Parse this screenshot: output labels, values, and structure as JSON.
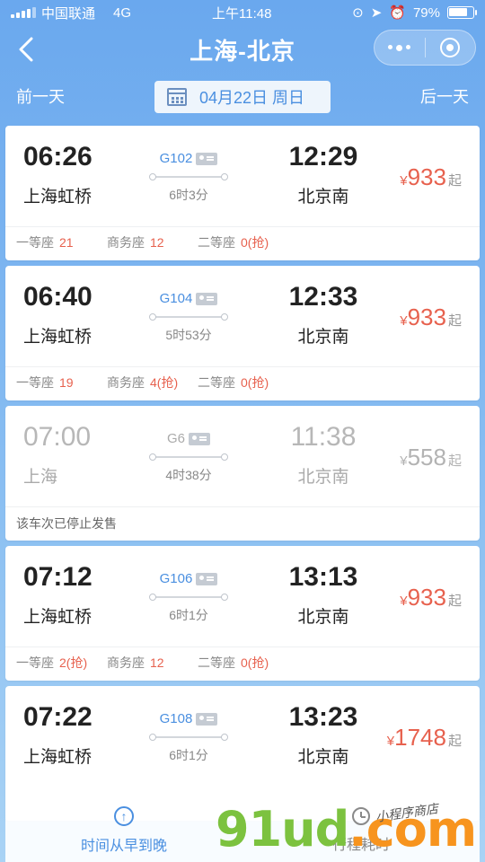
{
  "status_bar": {
    "carrier": "中国联通",
    "network": "4G",
    "time": "上午11:48",
    "battery": "79%",
    "battery_level": 0.79
  },
  "nav": {
    "title": "上海-北京"
  },
  "date_bar": {
    "prev_label": "前一天",
    "date": "04月22日 周日",
    "next_label": "后一天"
  },
  "trains": [
    {
      "dep_time": "06:26",
      "dep_station": "上海虹桥",
      "train_no": "G102",
      "duration": "6时3分",
      "arr_time": "12:29",
      "arr_station": "北京南",
      "price": "933",
      "price_prefix": "¥",
      "price_suffix": "起",
      "seats": [
        {
          "name": "一等座",
          "count": "21"
        },
        {
          "name": "商务座",
          "count": "12"
        },
        {
          "name": "二等座",
          "count": "0(抢)"
        }
      ],
      "disabled": false
    },
    {
      "dep_time": "06:40",
      "dep_station": "上海虹桥",
      "train_no": "G104",
      "duration": "5时53分",
      "arr_time": "12:33",
      "arr_station": "北京南",
      "price": "933",
      "price_prefix": "¥",
      "price_suffix": "起",
      "seats": [
        {
          "name": "一等座",
          "count": "19"
        },
        {
          "name": "商务座",
          "count": "4(抢)"
        },
        {
          "name": "二等座",
          "count": "0(抢)"
        }
      ],
      "disabled": false
    },
    {
      "dep_time": "07:00",
      "dep_station": "上海",
      "train_no": "G6",
      "duration": "4时38分",
      "arr_time": "11:38",
      "arr_station": "北京南",
      "price": "558",
      "price_prefix": "¥",
      "price_suffix": "起",
      "note": "该车次已停止发售",
      "disabled": true
    },
    {
      "dep_time": "07:12",
      "dep_station": "上海虹桥",
      "train_no": "G106",
      "duration": "6时1分",
      "arr_time": "13:13",
      "arr_station": "北京南",
      "price": "933",
      "price_prefix": "¥",
      "price_suffix": "起",
      "seats": [
        {
          "name": "一等座",
          "count": "2(抢)"
        },
        {
          "name": "商务座",
          "count": "12"
        },
        {
          "name": "二等座",
          "count": "0(抢)"
        }
      ],
      "disabled": false
    },
    {
      "dep_time": "07:22",
      "dep_station": "上海虹桥",
      "train_no": "G108",
      "duration": "6时1分",
      "arr_time": "13:23",
      "arr_station": "北京南",
      "price": "1748",
      "price_prefix": "¥",
      "price_suffix": "起",
      "disabled": false
    }
  ],
  "bottom_bar": {
    "sort_time_label": "时间从早到晚",
    "sort_duration_label": "行程耗时"
  },
  "watermark": {
    "main": "91ud",
    "suffix": ".com",
    "sub": "小程序商店"
  },
  "colors": {
    "accent": "#4a8fe0",
    "price": "#e7614e",
    "background": "#7fb6f0"
  }
}
